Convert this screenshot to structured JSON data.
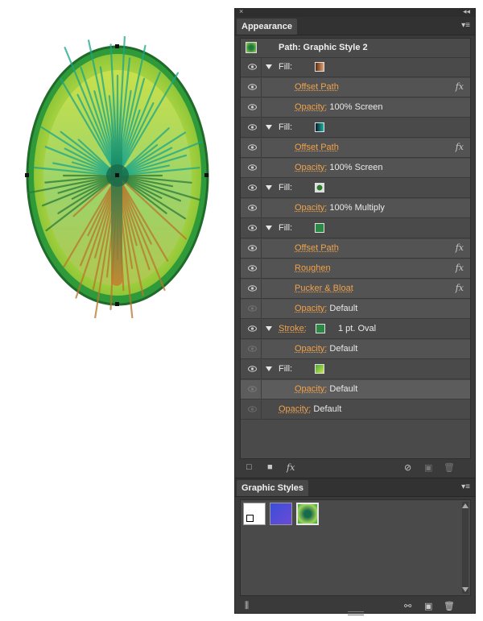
{
  "panel": {
    "close_glyph": "×",
    "collapse_glyph": "◂◂",
    "tab": "Appearance",
    "menu_glyph": "▾≡",
    "header": "Path: Graphic Style 2"
  },
  "rows": [
    {
      "kind": "fill",
      "label": "Fill:",
      "swatch": "gradient-brown"
    },
    {
      "kind": "effect",
      "label": "Offset Path",
      "fx": "fx"
    },
    {
      "kind": "opacity",
      "label": "Opacity:",
      "value": "100% Screen"
    },
    {
      "kind": "fill",
      "label": "Fill:",
      "swatch": "gradient-teal"
    },
    {
      "kind": "effect",
      "label": "Offset Path",
      "fx": "fx"
    },
    {
      "kind": "opacity",
      "label": "Opacity:",
      "value": "100% Screen"
    },
    {
      "kind": "fill",
      "label": "Fill:",
      "swatch": "radial-green"
    },
    {
      "kind": "opacity",
      "label": "Opacity:",
      "value": "100% Multiply"
    },
    {
      "kind": "fill",
      "label": "Fill:",
      "swatch": "solid-green"
    },
    {
      "kind": "effect",
      "label": "Offset Path",
      "fx": "fx"
    },
    {
      "kind": "effect",
      "label": "Roughen",
      "fx": "fx"
    },
    {
      "kind": "effect",
      "label": "Pucker & Bloat",
      "fx": "fx"
    },
    {
      "kind": "opacity",
      "label": "Opacity:",
      "value": "Default"
    },
    {
      "kind": "stroke",
      "label": "Stroke:",
      "swatch": "solid-green",
      "value": "1 pt. Oval"
    },
    {
      "kind": "opacity",
      "label": "Opacity:",
      "value": "Default"
    },
    {
      "kind": "fill",
      "label": "Fill:",
      "swatch": "gradient-lime"
    },
    {
      "kind": "opacity",
      "label": "Opacity:",
      "value": "Default"
    },
    {
      "kind": "root-opacity",
      "label": "Opacity:",
      "value": "Default"
    }
  ],
  "bottom_toolbar": {
    "new_stroke_glyph": "□",
    "new_fill_glyph": "■",
    "fx_glyph": "fx",
    "clear_glyph": "⊘",
    "duplicate_glyph": "▣",
    "delete_glyph": "🗑"
  },
  "graphic_styles": {
    "tab": "Graphic Styles",
    "menu_glyph": "▾≡",
    "library_glyph": "⫼",
    "break_glyph": "⚯",
    "new_glyph": "▣",
    "delete_glyph": "🗑"
  },
  "colors": {
    "link": "#f0a24b",
    "panel_bg": "#4a4a4a"
  }
}
